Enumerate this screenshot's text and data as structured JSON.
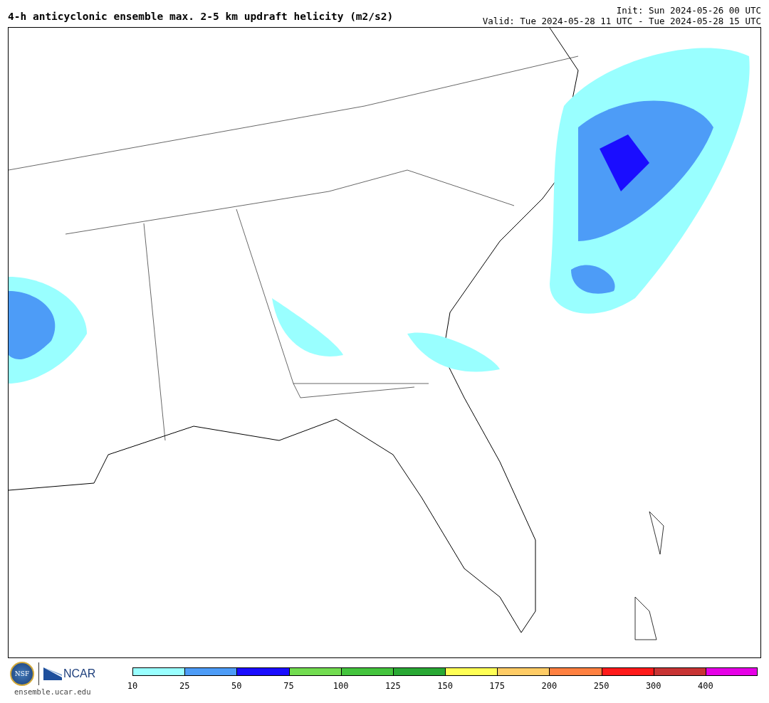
{
  "title": "4-h anticyclonic ensemble max. 2-5 km updraft helicity (m2/s2)",
  "init": "Init: Sun 2024-05-26 00 UTC",
  "valid": "Valid: Tue 2024-05-28 11 UTC - Tue 2024-05-28 15 UTC",
  "logo": {
    "seal": "NSF",
    "name": "NCAR",
    "url": "ensemble.ucar.edu"
  },
  "colorbar": [
    {
      "label": "10",
      "color": "#99ffff"
    },
    {
      "label": "25",
      "color": "#4d9cf7"
    },
    {
      "label": "50",
      "color": "#1a0dff"
    },
    {
      "label": "75",
      "color": "#72dc50"
    },
    {
      "label": "100",
      "color": "#44c43d"
    },
    {
      "label": "125",
      "color": "#29a834"
    },
    {
      "label": "150",
      "color": "#ffff55"
    },
    {
      "label": "175",
      "color": "#ffcc66"
    },
    {
      "label": "200",
      "color": "#ff8040"
    },
    {
      "label": "250",
      "color": "#ff1a1a"
    },
    {
      "label": "300",
      "color": "#c83434"
    },
    {
      "label": "400",
      "color": "#e600e6"
    }
  ]
}
